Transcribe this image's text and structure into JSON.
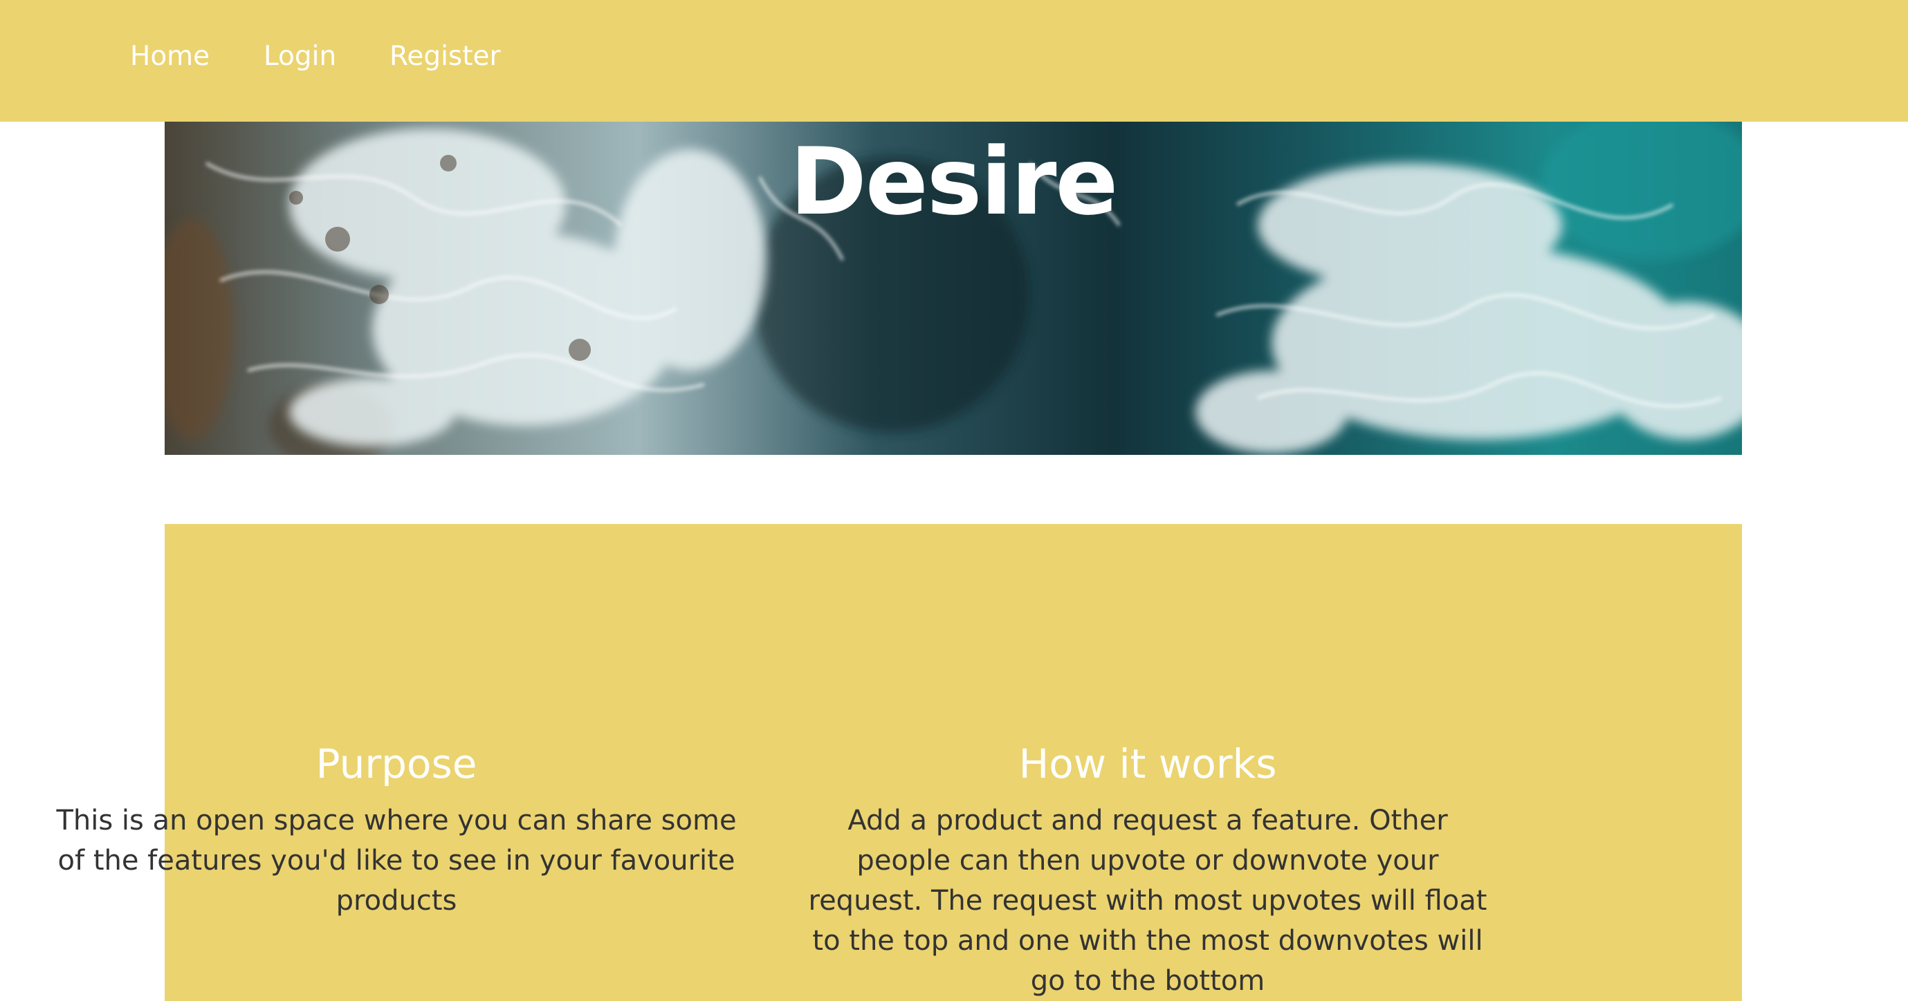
{
  "nav": {
    "items": [
      {
        "label": "Home"
      },
      {
        "label": "Login"
      },
      {
        "label": "Register"
      }
    ],
    "background": "#ebd36f"
  },
  "hero": {
    "title": "Desire",
    "image": "aerial-ocean-waves"
  },
  "info": {
    "background": "#ebd36f",
    "sections": [
      {
        "title": "Purpose",
        "text": "This is an open space where you can share some of the features you'd like to see in your favourite products"
      },
      {
        "title": "How it works",
        "text": "Add a product and request a feature. Other people can then upvote or downvote your request. The request with most upvotes will float to the top and one with the most downvotes will go to the bottom"
      }
    ]
  }
}
